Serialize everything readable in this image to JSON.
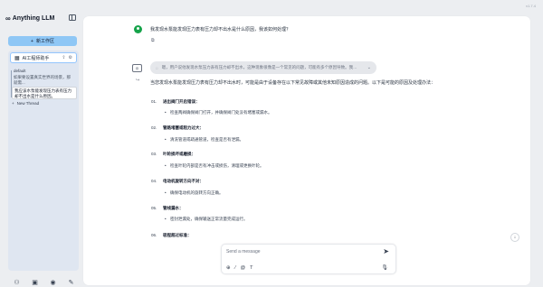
{
  "version": "v1.7.4",
  "brand": {
    "name": "Anything LLM",
    "logo": "infinity-logo"
  },
  "sidebar": {
    "new_workspace_label": "新工作区",
    "workspace": {
      "name": "AI工程师助手"
    },
    "threads": [
      {
        "label": "default"
      },
      {
        "label": "如果要设置真实世界的场景，那就需..."
      },
      {
        "label": "我应该水泵能发现压力表有压力却不出水是什么原因。"
      }
    ],
    "new_thread_label": "New Thread"
  },
  "chat": {
    "user_message": "我发现水泵能发现压力表有压力却不出水是什么原因，我该如何处理？",
    "thinking_text": "嗯，用户说他发现水泵压力表有压力却不出水，这种现象很像是一个常见的问题，可能有多个原因导致。我…",
    "answer_intro": "当您发现水泵能发现压力表有压力却不出水时，可能是由于设备存在以下常见故障或其他未知原因造成的问题。以下是可能的原因及处理办法：",
    "items": [
      {
        "num": "01.",
        "title": "进出阀门开启错误：",
        "desc": "检查两阀确保阀门打开，并确保阀门处没有堵塞或漏水。"
      },
      {
        "num": "02.",
        "title": "管路堵塞或阻力过大：",
        "desc": "清洗管道或疏通管道，检查是否有泄漏。"
      },
      {
        "num": "03.",
        "title": "叶轮损坏或磨损：",
        "desc": "检查叶轮内部是否有冲击或损伤，清理或更换叶轮。"
      },
      {
        "num": "04.",
        "title": "电动机旋转方向不对：",
        "desc": "确保电动机的旋转方向正确。"
      },
      {
        "num": "05.",
        "title": "管线漏水：",
        "desc": "密封泄漏处，确保输送正常流量完成运行。"
      },
      {
        "num": "06.",
        "title": "吸程超过标准：",
        "desc": ""
      }
    ]
  },
  "composer": {
    "placeholder": "Send a message",
    "tools": [
      "attach-icon",
      "slash-command-icon",
      "at-mention-icon",
      "text-size-icon"
    ]
  },
  "colors": {
    "accent": "#8fc7f5",
    "panel": "#dfe6f1",
    "avatar": "#16a34a"
  }
}
